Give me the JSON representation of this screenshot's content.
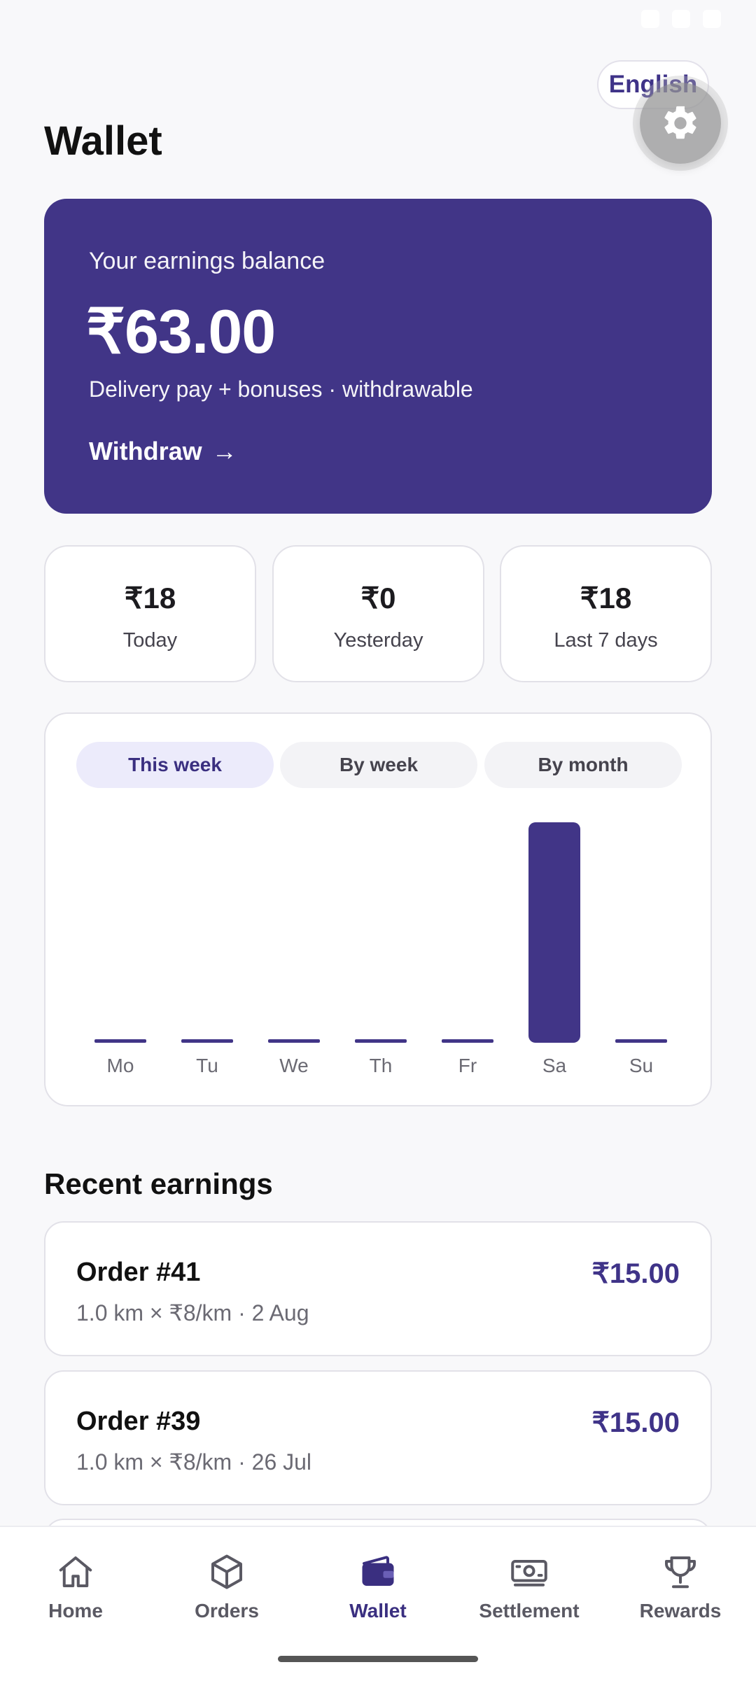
{
  "header": {
    "language": "English",
    "title": "Wallet"
  },
  "balance": {
    "label": "Your earnings balance",
    "amount": "₹63.00",
    "subtitle": "Delivery pay + bonuses · withdrawable",
    "withdraw_label": "Withdraw",
    "withdraw_arrow": "→"
  },
  "stats": [
    {
      "value": "₹18",
      "label": "Today"
    },
    {
      "value": "₹0",
      "label": "Yesterday"
    },
    {
      "value": "₹18",
      "label": "Last 7 days"
    }
  ],
  "chart": {
    "tabs": [
      "This week",
      "By week",
      "By month"
    ],
    "active_tab": "This week"
  },
  "chart_data": {
    "type": "bar",
    "categories": [
      "Mo",
      "Tu",
      "We",
      "Th",
      "Fr",
      "Sa",
      "Su"
    ],
    "values": [
      0,
      0,
      0,
      0,
      0,
      18,
      0
    ],
    "ylim": [
      0,
      18
    ],
    "grid": false,
    "color": "#413587"
  },
  "recent": {
    "title": "Recent earnings",
    "items": [
      {
        "title": "Order #41",
        "detail": "1.0 km × ₹8/km · 2 Aug",
        "amount": "₹15.00"
      },
      {
        "title": "Order #39",
        "detail": "1.0 km × ₹8/km · 26 Jul",
        "amount": "₹15.00"
      }
    ]
  },
  "nav": {
    "active": "Wallet",
    "items": [
      {
        "label": "Home",
        "icon": "home-icon"
      },
      {
        "label": "Orders",
        "icon": "box-icon"
      },
      {
        "label": "Wallet",
        "icon": "wallet-icon"
      },
      {
        "label": "Settlement",
        "icon": "cash-icon"
      },
      {
        "label": "Rewards",
        "icon": "trophy-icon"
      }
    ]
  },
  "colors": {
    "brand": "#413587",
    "background": "#f8f8fa"
  }
}
